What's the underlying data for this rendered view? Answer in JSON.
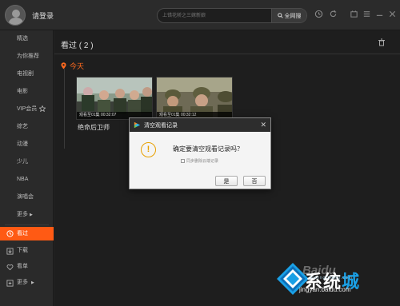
{
  "topbar": {
    "login_label": "请登录",
    "search_placeholder": "上错花轿之三嫁新娘",
    "search_button": "全网搜"
  },
  "sidebar": {
    "items": [
      {
        "label": "精选"
      },
      {
        "label": "为你推荐"
      },
      {
        "label": "电视剧"
      },
      {
        "label": "电影"
      },
      {
        "label": "VIP会员"
      },
      {
        "label": "综艺"
      },
      {
        "label": "动漫"
      },
      {
        "label": "少儿"
      },
      {
        "label": "NBA"
      },
      {
        "label": "演唱会"
      },
      {
        "label": "更多"
      }
    ],
    "bottom_items": [
      {
        "label": "看过",
        "active": true
      },
      {
        "label": "下载"
      },
      {
        "label": "看单"
      },
      {
        "label": "更多"
      }
    ]
  },
  "main": {
    "title": "看过 ( 2 )",
    "section_label": "今天",
    "videos": [
      {
        "title": "绝命后卫师",
        "progress_text": "观看至01集 00:32:07"
      },
      {
        "title": "",
        "progress_text": "观看至01集 00:32:12"
      }
    ]
  },
  "dialog": {
    "title": "清空观看记录",
    "message": "确定要清空观看记录吗？",
    "sync_label": "同步删除云端记录",
    "yes_label": "是",
    "no_label": "否"
  },
  "watermark": {
    "brand_a": "系统",
    "brand_b": "城",
    "site": "jingyan.baidu.com",
    "sub": "xitongcheng.com",
    "baidu": "Baidu"
  },
  "colors": {
    "accent": "#ff5a14",
    "background": "#1e1e1e",
    "sidebar": "#2a2a2a",
    "dialog_bg": "#f4f4f4"
  }
}
